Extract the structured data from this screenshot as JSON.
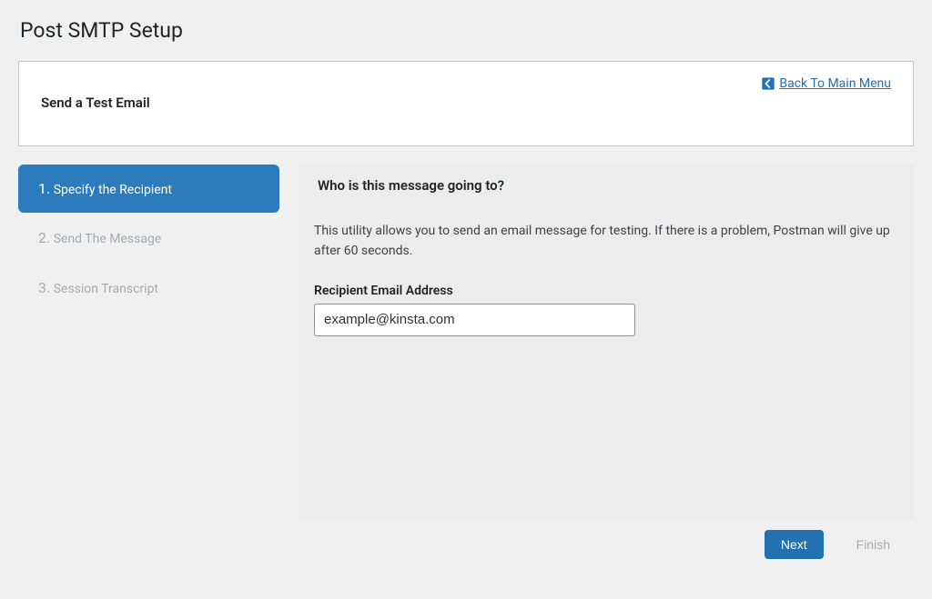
{
  "page": {
    "title": "Post SMTP Setup"
  },
  "card": {
    "title": "Send a Test Email",
    "back_link": "Back To Main Menu"
  },
  "wizard": {
    "steps": [
      {
        "number": "1.",
        "label": "Specify the Recipient",
        "active": true
      },
      {
        "number": "2.",
        "label": "Send The Message",
        "active": false
      },
      {
        "number": "3.",
        "label": "Session Transcript",
        "active": false
      }
    ],
    "content": {
      "heading": "Who is this message going to?",
      "description": "This utility allows you to send an email message for testing. If there is a problem, Postman will give up after 60 seconds.",
      "field_label": "Recipient Email Address",
      "email_value": "example@kinsta.com"
    },
    "buttons": {
      "next": "Next",
      "finish": "Finish"
    }
  }
}
